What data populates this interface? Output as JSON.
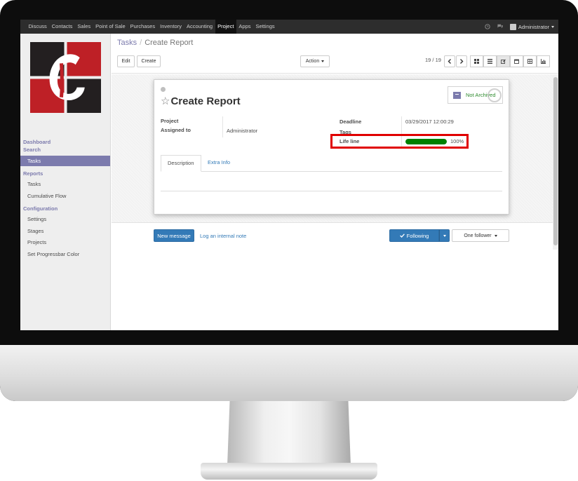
{
  "topnav": {
    "items": [
      "Discuss",
      "Contacts",
      "Sales",
      "Point of Sale",
      "Purchases",
      "Inventory",
      "Accounting",
      "Project",
      "Apps",
      "Settings"
    ],
    "active": "Project",
    "user": "Administrator"
  },
  "sidebar": {
    "dashboard_label": "Dashboard",
    "search_label": "Search",
    "tasks_active": "Tasks",
    "reports_header": "Reports",
    "reports_items": [
      "Tasks",
      "Cumulative Flow"
    ],
    "config_header": "Configuration",
    "config_items": [
      "Settings",
      "Stages",
      "Projects",
      "Set Progressbar Color"
    ]
  },
  "breadcrumb": {
    "parent": "Tasks",
    "separator": "/",
    "current": "Create Report"
  },
  "toolbar": {
    "edit": "Edit",
    "create": "Create",
    "action": "Action"
  },
  "pager": {
    "value": "19 / 19"
  },
  "record": {
    "title": "Create Report",
    "archive_label": "Not Archived",
    "fields": {
      "project_label": "Project",
      "assigned_label": "Assigned to",
      "assigned_value": "Administrator",
      "deadline_label": "Deadline",
      "deadline_value": "03/29/2017 12:00:29",
      "tags_label": "Tags",
      "lifeline_label": "Life line",
      "lifeline_text": "100%",
      "lifeline_percent": 100
    },
    "tabs": [
      "Description",
      "Extra Info"
    ]
  },
  "chatter": {
    "new_message": "New message",
    "log_note": "Log an internal note",
    "following": "Following",
    "followers": "One follower"
  },
  "colors": {
    "brand": "#7c7bad",
    "nav_bg": "#2d2d2d",
    "primary": "#337ab7",
    "progress": "#008000",
    "highlight": "#e00000"
  }
}
